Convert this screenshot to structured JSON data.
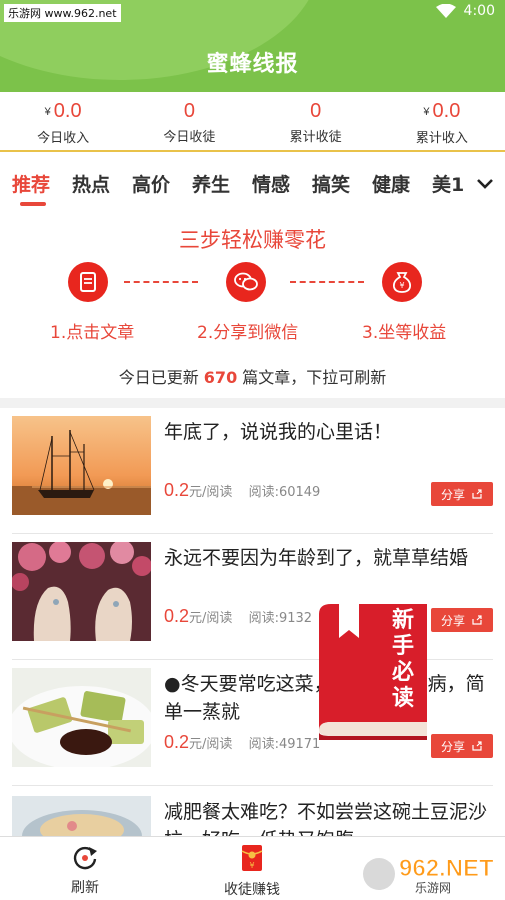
{
  "status_bar": {
    "watermark": "乐游网 www.962.net",
    "time": "4:00"
  },
  "app": {
    "title": "蜜蜂线报"
  },
  "stats": [
    {
      "value": "0.0",
      "currency": "¥",
      "label": "今日收入"
    },
    {
      "value": "0",
      "currency": "",
      "label": "今日收徒"
    },
    {
      "value": "0",
      "currency": "",
      "label": "累计收徒"
    },
    {
      "value": "0.0",
      "currency": "¥",
      "label": "累计收入"
    }
  ],
  "tabs": [
    "推荐",
    "热点",
    "高价",
    "养生",
    "情感",
    "搞笑",
    "健康",
    "美1"
  ],
  "steps": {
    "title": "三步轻松赚零花",
    "items": [
      {
        "label": "1.点击文章",
        "icon": "article-icon"
      },
      {
        "label": "2.分享到微信",
        "icon": "wechat-icon"
      },
      {
        "label": "3.坐等收益",
        "icon": "money-bag-icon"
      }
    ]
  },
  "update": {
    "prefix": "今日已更新",
    "count": "670",
    "suffix": "篇文章，下拉可刷新"
  },
  "articles": [
    {
      "title": "年底了，说说我的心里话！",
      "price": "0.2",
      "unit": "元/阅读",
      "reads": "阅读:60149",
      "share": "分享"
    },
    {
      "title": "永远不要因为年龄到了，就草草结婚",
      "price": "0.2",
      "unit": "元/阅读",
      "reads": "阅读:9132",
      "share": "分享"
    },
    {
      "title": "●冬天要常吃这菜，抵抗力不生病，简单一蒸就",
      "price": "0.2",
      "unit": "元/阅读",
      "reads": "阅读:49171",
      "share": "分享"
    },
    {
      "title": "减肥餐太难吃？不如尝尝这碗土豆泥沙拉，好吃，低热又饱腹",
      "price": "",
      "unit": "",
      "reads": "",
      "share": ""
    }
  ],
  "newbie_book": {
    "text": "新手必读"
  },
  "bottom_nav": [
    {
      "label": "刷新",
      "icon": "refresh-icon"
    },
    {
      "label": "收徒赚钱",
      "icon": "red-packet-icon"
    }
  ],
  "watermark_br": {
    "text": "962.NET",
    "sub": "乐游网"
  },
  "colors": {
    "green": "#7cc24a",
    "accent": "#e8473a"
  }
}
